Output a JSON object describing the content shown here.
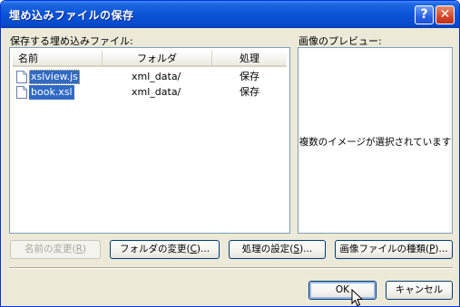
{
  "window": {
    "title": "埋め込みファイルの保存"
  },
  "files_panel": {
    "label": "保存する埋め込みファイル:",
    "columns": [
      "名前",
      "フォルダ",
      "処理"
    ],
    "rows": [
      {
        "name": "xslview.js",
        "folder": "xml_data/",
        "action": "保存"
      },
      {
        "name": "book.xsl",
        "folder": "xml_data/",
        "action": "保存"
      }
    ]
  },
  "preview_panel": {
    "label": "画像のプレビュー:",
    "message": "複数のイメージが選択されています"
  },
  "buttons": {
    "rename": {
      "text": "名前の変更(",
      "accel": "R",
      "close": ")"
    },
    "change_folder": {
      "text": "フォルダの変更(",
      "accel": "C",
      "close": ")..."
    },
    "action_settings": {
      "text": "処理の設定(",
      "accel": "S",
      "close": ")..."
    },
    "image_type": {
      "text": "画像ファイルの種類(",
      "accel": "P",
      "close": ")..."
    },
    "ok": "OK",
    "cancel": "キャンセル"
  },
  "titlebar_buttons": {
    "help": "?",
    "close": "✕"
  },
  "colors": {
    "titlebar": "#0A53D8",
    "dialog_bg": "#ECE9D8",
    "selection": "#316AC5"
  }
}
